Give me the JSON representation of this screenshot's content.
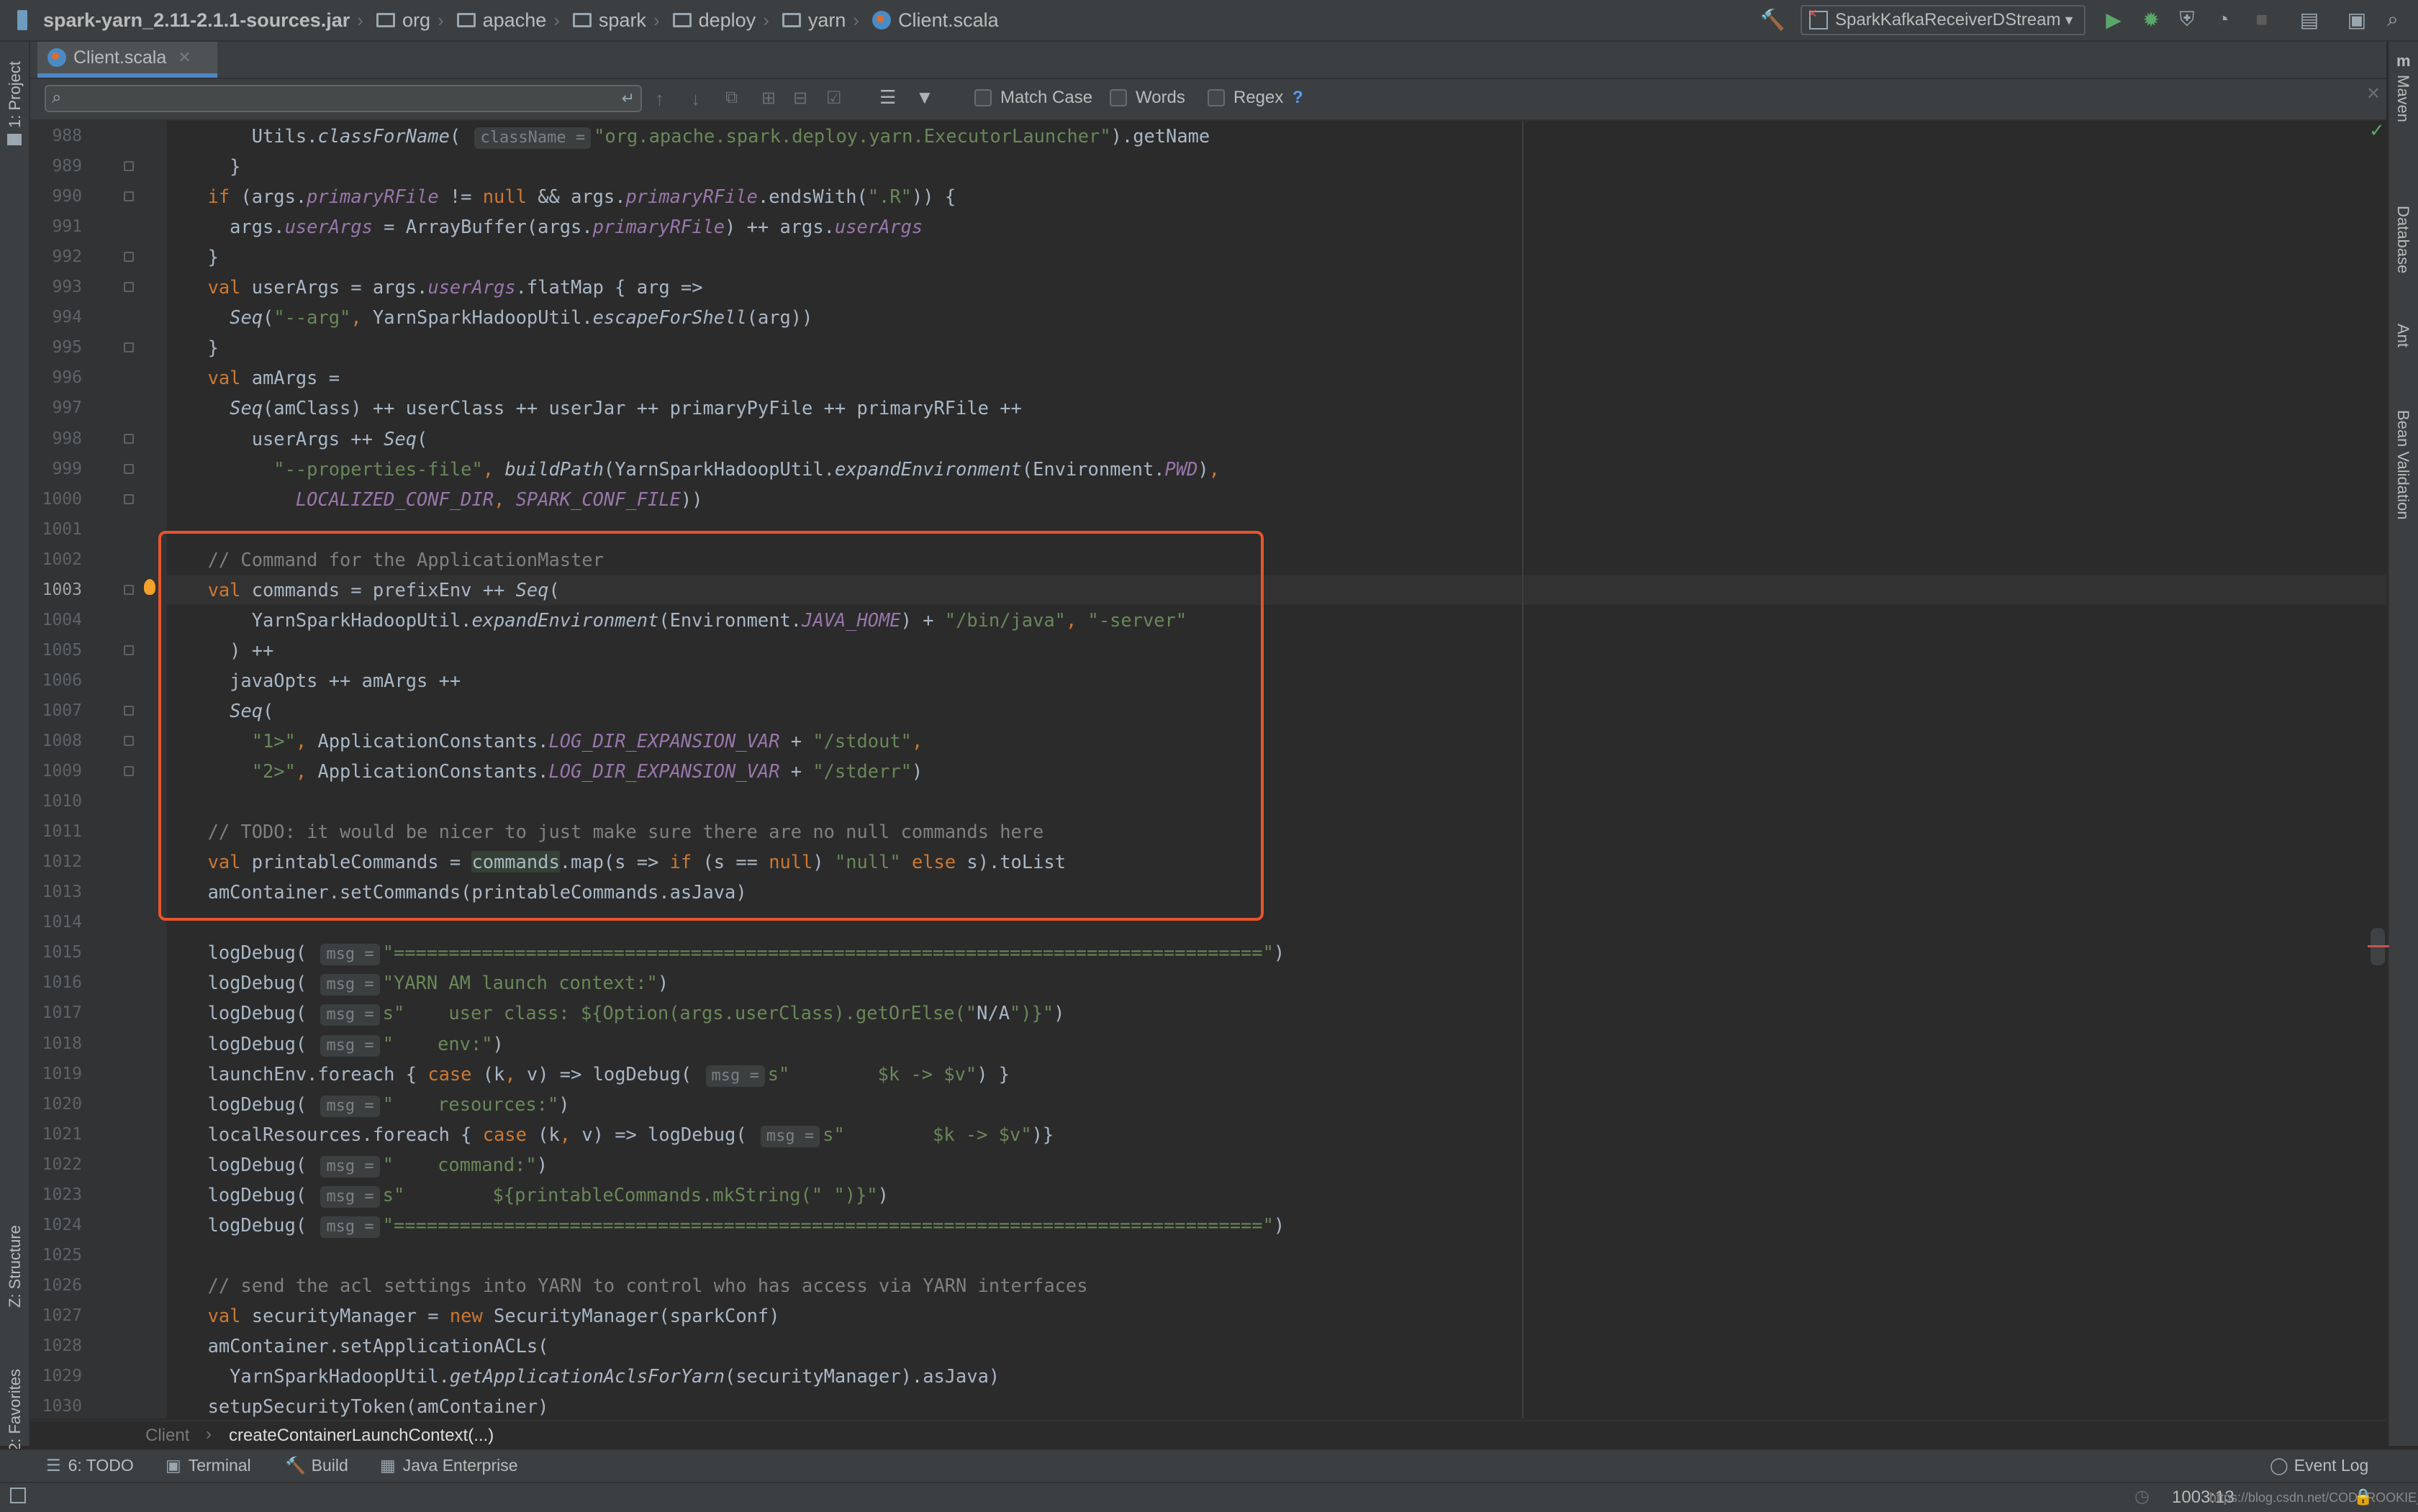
{
  "navbar": {
    "crumbs": [
      "spark-yarn_2.11-2.1.1-sources.jar",
      "org",
      "apache",
      "spark",
      "deploy",
      "yarn",
      "Client.scala"
    ],
    "run_config": "SparkKafkaReceiverDStream"
  },
  "left_tools": {
    "project": "1: Project",
    "structure": "Z: Structure",
    "favorites": "2: Favorites"
  },
  "right_tools": {
    "maven": "Maven",
    "database": "Database",
    "ant": "Ant",
    "bean": "Bean Validation"
  },
  "editor_tab": "Client.scala",
  "search": {
    "match_case": "Match Case",
    "words": "Words",
    "regex": "Regex",
    "help": "?"
  },
  "line_numbers": [
    "988",
    "989",
    "990",
    "991",
    "992",
    "993",
    "994",
    "995",
    "996",
    "997",
    "998",
    "999",
    "1000",
    "1001",
    "1002",
    "1003",
    "1004",
    "1005",
    "1006",
    "1007",
    "1008",
    "1009",
    "1010",
    "1011",
    "1012",
    "1013",
    "1014",
    "1015",
    "1016",
    "1017",
    "1018",
    "1019",
    "1020",
    "1021",
    "1022",
    "1023",
    "1024",
    "1025",
    "1026",
    "1027",
    "1028",
    "1029",
    "1030"
  ],
  "code_lines": [
    "      Utils.classForName( className = \"org.apache.spark.deploy.yarn.ExecutorLauncher\").getName",
    "    }",
    "  if (args.primaryRFile != null && args.primaryRFile.endsWith(\".R\")) {",
    "    args.userArgs = ArrayBuffer(args.primaryRFile) ++ args.userArgs",
    "  }",
    "  val userArgs = args.userArgs.flatMap { arg =>",
    "    Seq(\"--arg\", YarnSparkHadoopUtil.escapeForShell(arg))",
    "  }",
    "  val amArgs =",
    "    Seq(amClass) ++ userClass ++ userJar ++ primaryPyFile ++ primaryRFile ++",
    "      userArgs ++ Seq(",
    "        \"--properties-file\", buildPath(YarnSparkHadoopUtil.expandEnvironment(Environment.PWD),",
    "          LOCALIZED_CONF_DIR, SPARK_CONF_FILE))",
    "",
    "  // Command for the ApplicationMaster",
    "  val commands = prefixEnv ++ Seq(",
    "      YarnSparkHadoopUtil.expandEnvironment(Environment.JAVA_HOME) + \"/bin/java\", \"-server\"",
    "    ) ++",
    "    javaOpts ++ amArgs ++",
    "    Seq(",
    "      \"1>\", ApplicationConstants.LOG_DIR_EXPANSION_VAR + \"/stdout\",",
    "      \"2>\", ApplicationConstants.LOG_DIR_EXPANSION_VAR + \"/stderr\")",
    "",
    "  // TODO: it would be nicer to just make sure there are no null commands here",
    "  val printableCommands = commands.map(s => if (s == null) \"null\" else s).toList",
    "  amContainer.setCommands(printableCommands.asJava)",
    "",
    "  logDebug( msg = \"===============================================================================\")",
    "  logDebug( msg = \"YARN AM launch context:\")",
    "  logDebug( msg = s\"    user class: ${Option(args.userClass).getOrElse(\"N/A\")}\")",
    "  logDebug( msg = \"    env:\")",
    "  launchEnv.foreach { case (k, v) => logDebug( msg = s\"        $k -> $v\") }",
    "  logDebug( msg = \"    resources:\")",
    "  localResources.foreach { case (k, v) => logDebug( msg = s\"        $k -> $v\")}",
    "  logDebug( msg = \"    command:\")",
    "  logDebug( msg = s\"        ${printableCommands.mkString(\" \")}\")",
    "  logDebug( msg = \"===============================================================================\")",
    "",
    "  // send the acl settings into YARN to control who has access via YARN interfaces",
    "  val securityManager = new SecurityManager(sparkConf)",
    "  amContainer.setApplicationACLs(",
    "    YarnSparkHadoopUtil.getApplicationAclsForYarn(securityManager).asJava)",
    "  setupSecurityToken(amContainer)"
  ],
  "breadcrumb": {
    "class": "Client",
    "method": "createContainerLaunchContext(...)"
  },
  "bottom_tabs": {
    "todo": "6: TODO",
    "terminal": "Terminal",
    "build": "Build",
    "java_enterprise": "Java Enterprise",
    "event_log": "Event Log"
  },
  "status": {
    "position": "1003:13",
    "watermark": "https://blog.csdn.net/CODEROOKIE_RUN"
  }
}
